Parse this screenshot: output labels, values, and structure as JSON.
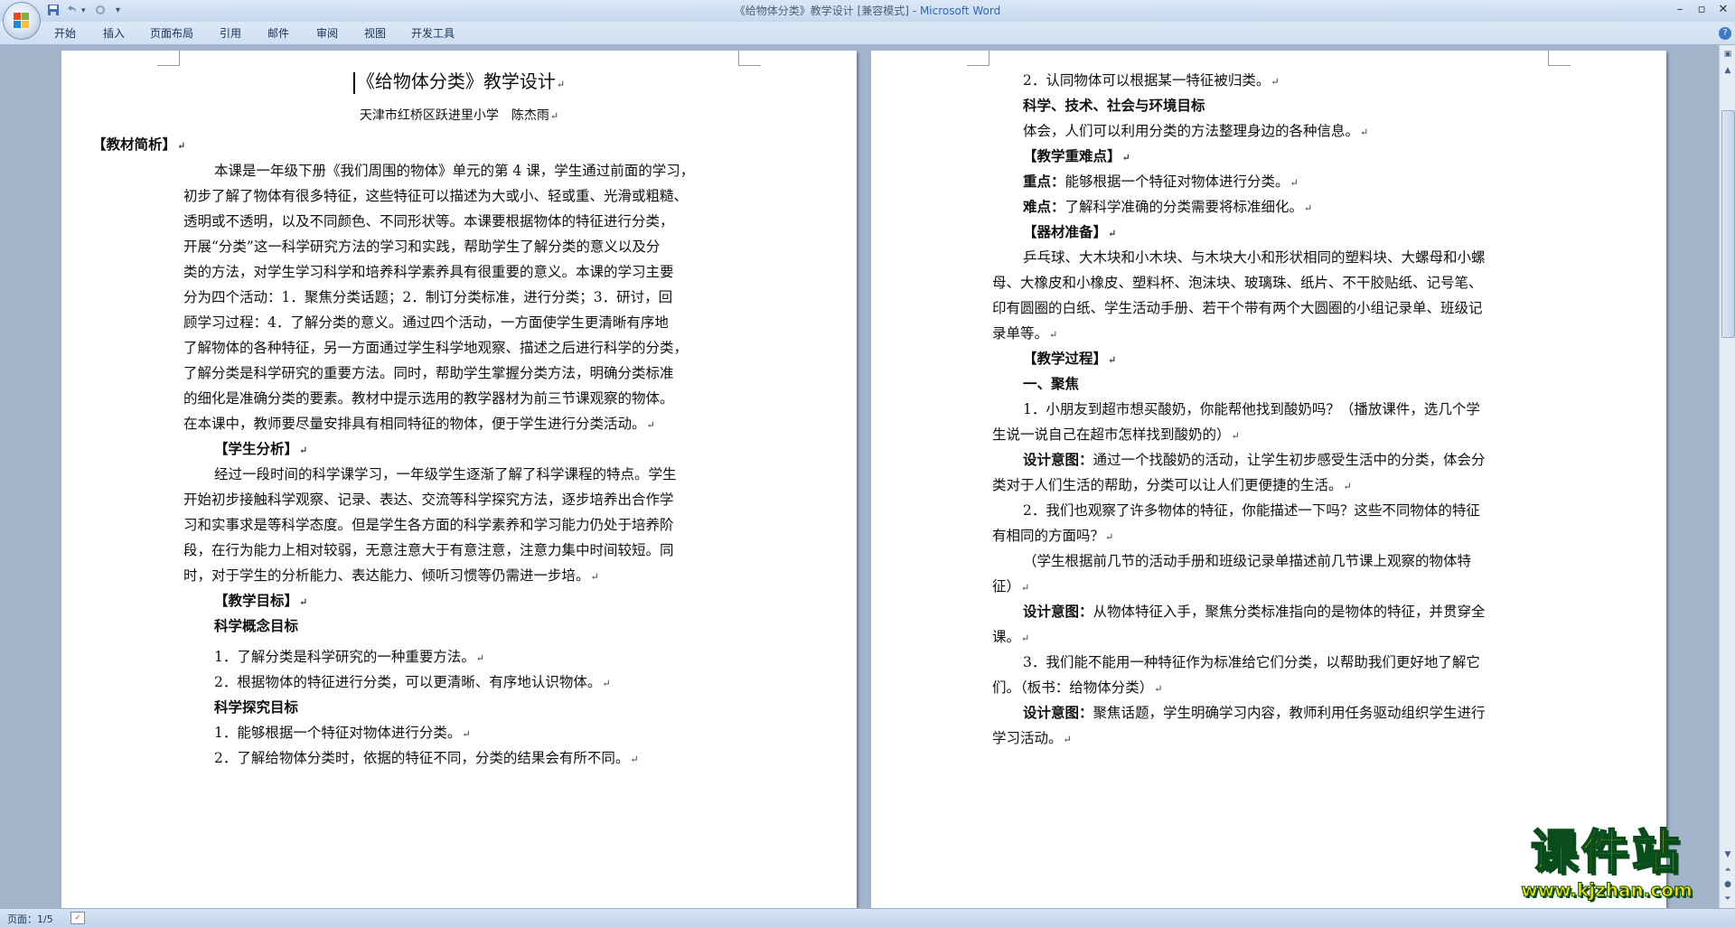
{
  "window": {
    "doc_name": "《给物体分类》教学设计 [兼容模式]",
    "separator": " - ",
    "app_name": "Microsoft Word",
    "minimize": "–",
    "restore": "▫",
    "close": "✕"
  },
  "ribbon": {
    "tabs": [
      "开始",
      "插入",
      "页面布局",
      "引用",
      "邮件",
      "审阅",
      "视图",
      "开发工具"
    ]
  },
  "page1": {
    "title": "《给物体分类》教学设计",
    "author": "天津市红桥区跃进里小学　陈杰雨",
    "lines": [
      "【教材简析】",
      "本课是一年级下册《我们周围的物体》单元的第 4 课，学生通过前面的学习，",
      "初步了解了物体有很多特征，这些特征可以描述为大或小、轻或重、光滑或粗糙、",
      "透明或不透明，以及不同颜色、不同形状等。本课要根据物体的特征进行分类，",
      "开展“分类”这一科学研究方法的学习和实践，帮助学生了解分类的意义以及分",
      "类的方法，对学生学习科学和培养科学素养具有很重要的意义。本课的学习主要",
      "分为四个活动：1．聚焦分类话题；2．制订分类标准，进行分类；3．研讨，回",
      "顾学习过程：4．了解分类的意义。通过四个活动，一方面使学生更清晰有序地",
      "了解物体的各种特征，另一方面通过学生科学地观察、描述之后进行科学的分类，",
      "了解分类是科学研究的重要方法。同时，帮助学生掌握分类方法，明确分类标准",
      "的细化是准确分类的要素。教材中提示选用的教学器材为前三节课观察的物体。",
      "在本课中，教师要尽量安排具有相同特征的物体，便于学生进行分类活动。",
      "【学生分析】",
      "经过一段时间的科学课学习，一年级学生逐渐了解了科学课程的特点。学生",
      "开始初步接触科学观察、记录、表达、交流等科学探究方法，逐步培养出合作学",
      "习和实事求是等科学态度。但是学生各方面的科学素养和学习能力仍处于培养阶",
      "段，在行为能力上相对较弱，无意注意大于有意注意，注意力集中时间较短。同",
      "时，对于学生的分析能力、表达能力、倾听习惯等仍需进一步培。",
      "【教学目标】",
      "科学概念目标",
      "1．了解分类是科学研究的一种重要方法。",
      "2．根据物体的特征进行分类，可以更清晰、有序地认识物体。",
      "科学探究目标",
      "1．能够根据一个特征对物体进行分类。",
      "2．了解给物体分类时，依据的特征不同，分类的结果会有所不同。"
    ]
  },
  "page2": {
    "lines": [
      "2．认同物体可以根据某一特征被归类。",
      "科学、技术、社会与环境目标",
      "体会，人们可以利用分类的方法整理身边的各种信息。",
      "【教学重难点】",
      "重点：",
      "能够根据一个特征对物体进行分类。",
      "难点：",
      "了解科学准确的分类需要将标准细化。",
      "【器材准备】",
      "乒乓球、大木块和小木块、与木块大小和形状相同的塑料块、大螺母和小螺",
      "母、大橡皮和小橡皮、塑料杯、泡沫块、玻璃珠、纸片、不干胶贴纸、记号笔、",
      "印有圆圈的白纸、学生活动手册、若干个带有两个大圆圈的小组记录单、班级记",
      "录单等。",
      "【教学过程】",
      "一、聚焦",
      "1．小朋友到超市想买酸奶，你能帮他找到酸奶吗？（播放课件，选几个学",
      "生说一说自己在超市怎样找到酸奶的）",
      "设计意图：",
      "通过一个找酸奶的活动，让学生初步感受生活中的分类，体会分",
      "类对于人们生活的帮助，分类可以让人们更便捷的生活。",
      "2．我们也观察了许多物体的特征，你能描述一下吗？这些不同物体的特征",
      "有相同的方面吗？",
      "（学生根据前几节的活动手册和班级记录单描述前几节课上观察的物体特",
      "征）",
      "设计意图：",
      "从物体特征入手，聚焦分类标准指向的是物体的特征，并贯穿全",
      "课。",
      "3．我们能不能用一种特征作为标准给它们分类，以帮助我们更好地了解它",
      "们。（板书：给物体分类）",
      "设计意图：",
      "聚焦话题，学生明确学习内容，教师利用任务驱动组织学生进行",
      "学习活动。"
    ]
  },
  "status": {
    "page": "页面：1/5"
  },
  "watermark": {
    "main": "课件站",
    "url": "www.kjzhan.com"
  }
}
